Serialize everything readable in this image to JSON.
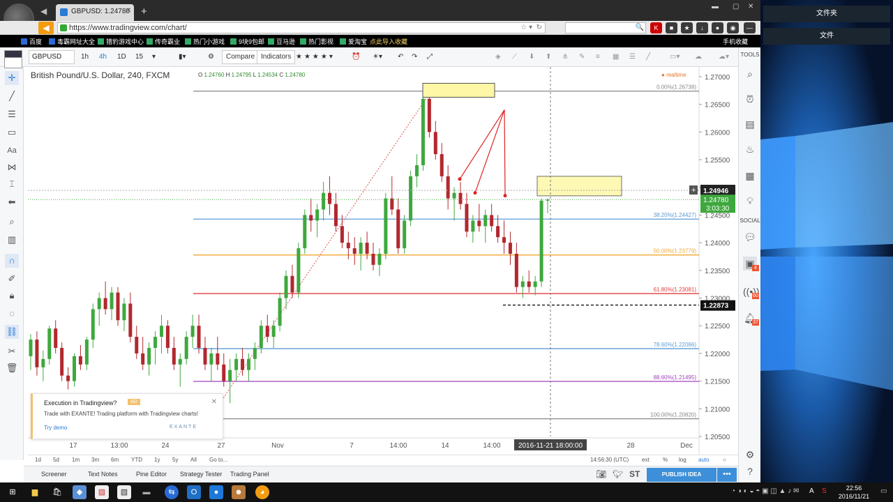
{
  "browser": {
    "tab_title": "GBPUSD: 1.24780",
    "url": "https://www.tradingview.com/chart/",
    "bookmarks": [
      "百度",
      "毒霸网址大全",
      "猎豹游戏中心",
      "传奇霸业",
      "热门小游戏",
      "9块9包邮",
      "豆马逊",
      "热门影视",
      "爱淘宝",
      "点此导入收藏"
    ],
    "mobile_favorites": "手机收藏"
  },
  "toolbar": {
    "symbol": "GBPUSD",
    "intervals": [
      "1h",
      "4h",
      "1D",
      "15"
    ],
    "active_interval": "4h",
    "compare": "Compare",
    "indicators": "Indicators"
  },
  "legend": {
    "title": "British Pound/U.S. Dollar, 240, FXCM",
    "open_label": "O",
    "open": "1.24760",
    "high_label": "H",
    "high": "1.24795",
    "low_label": "L",
    "low": "1.24534",
    "close_label": "C",
    "close": "1.24780",
    "realtime": "realtime"
  },
  "chart_data": {
    "type": "candlestick",
    "symbol": "GBPUSD",
    "y_ticks": [
      "1.27000",
      "1.26500",
      "1.26000",
      "1.25500",
      "1.25000",
      "1.24500",
      "1.24000",
      "1.23500",
      "1.23000",
      "1.22500",
      "1.22000",
      "1.21500",
      "1.21000",
      "1.20500"
    ],
    "ylim": [
      1.205,
      1.271
    ],
    "x_ticks": [
      "17",
      "13:00",
      "24",
      "27",
      "Nov",
      "7",
      "14:00",
      "14",
      "14:00",
      "21",
      "28",
      "Dec"
    ],
    "crosshair_time": "2016-11-21 18:00:00",
    "crosshair_price": "1.24946",
    "last_price": "1.24780",
    "countdown": "3:03:30",
    "level_price": "1.22873",
    "fib_levels": [
      {
        "label": "0.00%(1.26738)",
        "price": 1.26738,
        "color": "#888888"
      },
      {
        "label": "38.20%(1.24427)",
        "price": 1.24427,
        "color": "#5b9bd5"
      },
      {
        "label": "50.00%(1.23779)",
        "price": 1.23779,
        "color": "#f0a830"
      },
      {
        "label": "61.80%(1.23081)",
        "price": 1.23081,
        "color": "#e03c3c"
      },
      {
        "label": "78.60%(1.22086)",
        "price": 1.22086,
        "color": "#5b9bd5"
      },
      {
        "label": "88.60%(1.21495)",
        "price": 1.21495,
        "color": "#a040c0"
      },
      {
        "label": "100.00%(1.20820)",
        "price": 1.2082,
        "color": "#888888"
      }
    ],
    "candles": [
      [
        1.2195,
        1.2235,
        1.217,
        1.2225
      ],
      [
        1.2225,
        1.224,
        1.216,
        1.2175
      ],
      [
        1.2175,
        1.2205,
        1.215,
        1.219
      ],
      [
        1.219,
        1.225,
        1.218,
        1.2245
      ],
      [
        1.2245,
        1.226,
        1.22,
        1.221
      ],
      [
        1.221,
        1.222,
        1.215,
        1.216
      ],
      [
        1.216,
        1.2175,
        1.2135,
        1.215
      ],
      [
        1.215,
        1.22,
        1.214,
        1.2195
      ],
      [
        1.2195,
        1.2215,
        1.217,
        1.218
      ],
      [
        1.218,
        1.223,
        1.217,
        1.2225
      ],
      [
        1.2225,
        1.229,
        1.221,
        1.228
      ],
      [
        1.228,
        1.231,
        1.225,
        1.23
      ],
      [
        1.23,
        1.233,
        1.227,
        1.228
      ],
      [
        1.228,
        1.232,
        1.226,
        1.231
      ],
      [
        1.231,
        1.232,
        1.225,
        1.226
      ],
      [
        1.226,
        1.23,
        1.224,
        1.229
      ],
      [
        1.229,
        1.231,
        1.222,
        1.223
      ],
      [
        1.223,
        1.225,
        1.219,
        1.22
      ],
      [
        1.22,
        1.223,
        1.217,
        1.218
      ],
      [
        1.218,
        1.222,
        1.216,
        1.221
      ],
      [
        1.221,
        1.224,
        1.218,
        1.223
      ],
      [
        1.223,
        1.227,
        1.22,
        1.225
      ],
      [
        1.225,
        1.226,
        1.22,
        1.221
      ],
      [
        1.221,
        1.223,
        1.217,
        1.218
      ],
      [
        1.218,
        1.22,
        1.214,
        1.219
      ],
      [
        1.219,
        1.224,
        1.218,
        1.223
      ],
      [
        1.223,
        1.227,
        1.221,
        1.225
      ],
      [
        1.225,
        1.227,
        1.22,
        1.221
      ],
      [
        1.221,
        1.223,
        1.217,
        1.218
      ],
      [
        1.218,
        1.221,
        1.215,
        1.22
      ],
      [
        1.22,
        1.223,
        1.217,
        1.218
      ],
      [
        1.218,
        1.22,
        1.214,
        1.215
      ],
      [
        1.215,
        1.219,
        1.211,
        1.217
      ],
      [
        1.217,
        1.22,
        1.215,
        1.219
      ],
      [
        1.219,
        1.221,
        1.216,
        1.217
      ],
      [
        1.217,
        1.22,
        1.215,
        1.219
      ],
      [
        1.219,
        1.222,
        1.217,
        1.221
      ],
      [
        1.221,
        1.226,
        1.22,
        1.225
      ],
      [
        1.225,
        1.227,
        1.222,
        1.223
      ],
      [
        1.223,
        1.226,
        1.221,
        1.225
      ],
      [
        1.225,
        1.231,
        1.224,
        1.23
      ],
      [
        1.23,
        1.235,
        1.228,
        1.234
      ],
      [
        1.234,
        1.236,
        1.23,
        1.231
      ],
      [
        1.231,
        1.24,
        1.23,
        1.239
      ],
      [
        1.239,
        1.246,
        1.238,
        1.245
      ],
      [
        1.245,
        1.248,
        1.242,
        1.244
      ],
      [
        1.244,
        1.247,
        1.241,
        1.246
      ],
      [
        1.246,
        1.251,
        1.244,
        1.249
      ],
      [
        1.249,
        1.252,
        1.245,
        1.247
      ],
      [
        1.247,
        1.249,
        1.242,
        1.243
      ],
      [
        1.243,
        1.245,
        1.239,
        1.24
      ],
      [
        1.24,
        1.242,
        1.237,
        1.239
      ],
      [
        1.239,
        1.241,
        1.236,
        1.238
      ],
      [
        1.238,
        1.241,
        1.235,
        1.24
      ],
      [
        1.24,
        1.242,
        1.237,
        1.238
      ],
      [
        1.238,
        1.24,
        1.235,
        1.236
      ],
      [
        1.236,
        1.239,
        1.234,
        1.238
      ],
      [
        1.238,
        1.249,
        1.237,
        1.248
      ],
      [
        1.248,
        1.252,
        1.245,
        1.246
      ],
      [
        1.246,
        1.248,
        1.238,
        1.239
      ],
      [
        1.239,
        1.245,
        1.238,
        1.244
      ],
      [
        1.244,
        1.253,
        1.243,
        1.252
      ],
      [
        1.252,
        1.256,
        1.25,
        1.254
      ],
      [
        1.254,
        1.267,
        1.253,
        1.266
      ],
      [
        1.266,
        1.2674,
        1.259,
        1.26
      ],
      [
        1.26,
        1.262,
        1.255,
        1.256
      ],
      [
        1.256,
        1.258,
        1.251,
        1.252
      ],
      [
        1.252,
        1.254,
        1.246,
        1.248
      ],
      [
        1.248,
        1.25,
        1.244,
        1.249
      ],
      [
        1.249,
        1.251,
        1.246,
        1.247
      ],
      [
        1.247,
        1.249,
        1.241,
        1.242
      ],
      [
        1.242,
        1.245,
        1.24,
        1.244
      ],
      [
        1.244,
        1.247,
        1.242,
        1.243
      ],
      [
        1.243,
        1.246,
        1.24,
        1.245
      ],
      [
        1.245,
        1.247,
        1.242,
        1.243
      ],
      [
        1.243,
        1.245,
        1.24,
        1.241
      ],
      [
        1.241,
        1.244,
        1.238,
        1.24
      ],
      [
        1.24,
        1.242,
        1.236,
        1.238
      ],
      [
        1.238,
        1.24,
        1.231,
        1.232
      ],
      [
        1.232,
        1.234,
        1.23,
        1.233
      ],
      [
        1.233,
        1.235,
        1.231,
        1.232
      ],
      [
        1.232,
        1.234,
        1.2305,
        1.233
      ],
      [
        1.233,
        1.248,
        1.232,
        1.2476
      ],
      [
        1.2476,
        1.248,
        1.2453,
        1.2478
      ]
    ]
  },
  "annotations": {
    "countdown": "3:03:30"
  },
  "bottom_bar": {
    "ranges": [
      "1d",
      "5d",
      "1m",
      "3m",
      "6m",
      "YTD",
      "1y",
      "5y",
      "All",
      "Go to..."
    ],
    "time": "14:56:30 (UTC)",
    "options": [
      "ext",
      "%",
      "log",
      "auto"
    ]
  },
  "footer_tabs": [
    "Screener",
    "Text Notes",
    "Pine Editor",
    "Strategy Tester",
    "Trading Panel"
  ],
  "publish_label": "PUBLISH IDEA",
  "right_panel": {
    "tools_label": "TOOLS",
    "social_label": "SOCIAL",
    "badges": [
      "4",
      "60",
      "37"
    ]
  },
  "popup": {
    "title": "Execution in Tradingview?",
    "ad": "AD",
    "body": "Trade with EXANTE! Trading platform with Tradingview charts!",
    "link": "Try demo",
    "brand": "EXANTE"
  },
  "desktop": {
    "folder1": "文件夹",
    "folder2": "文件"
  },
  "taskbar": {
    "time": "22:56",
    "date": "2016/11/21",
    "ime": "A"
  }
}
